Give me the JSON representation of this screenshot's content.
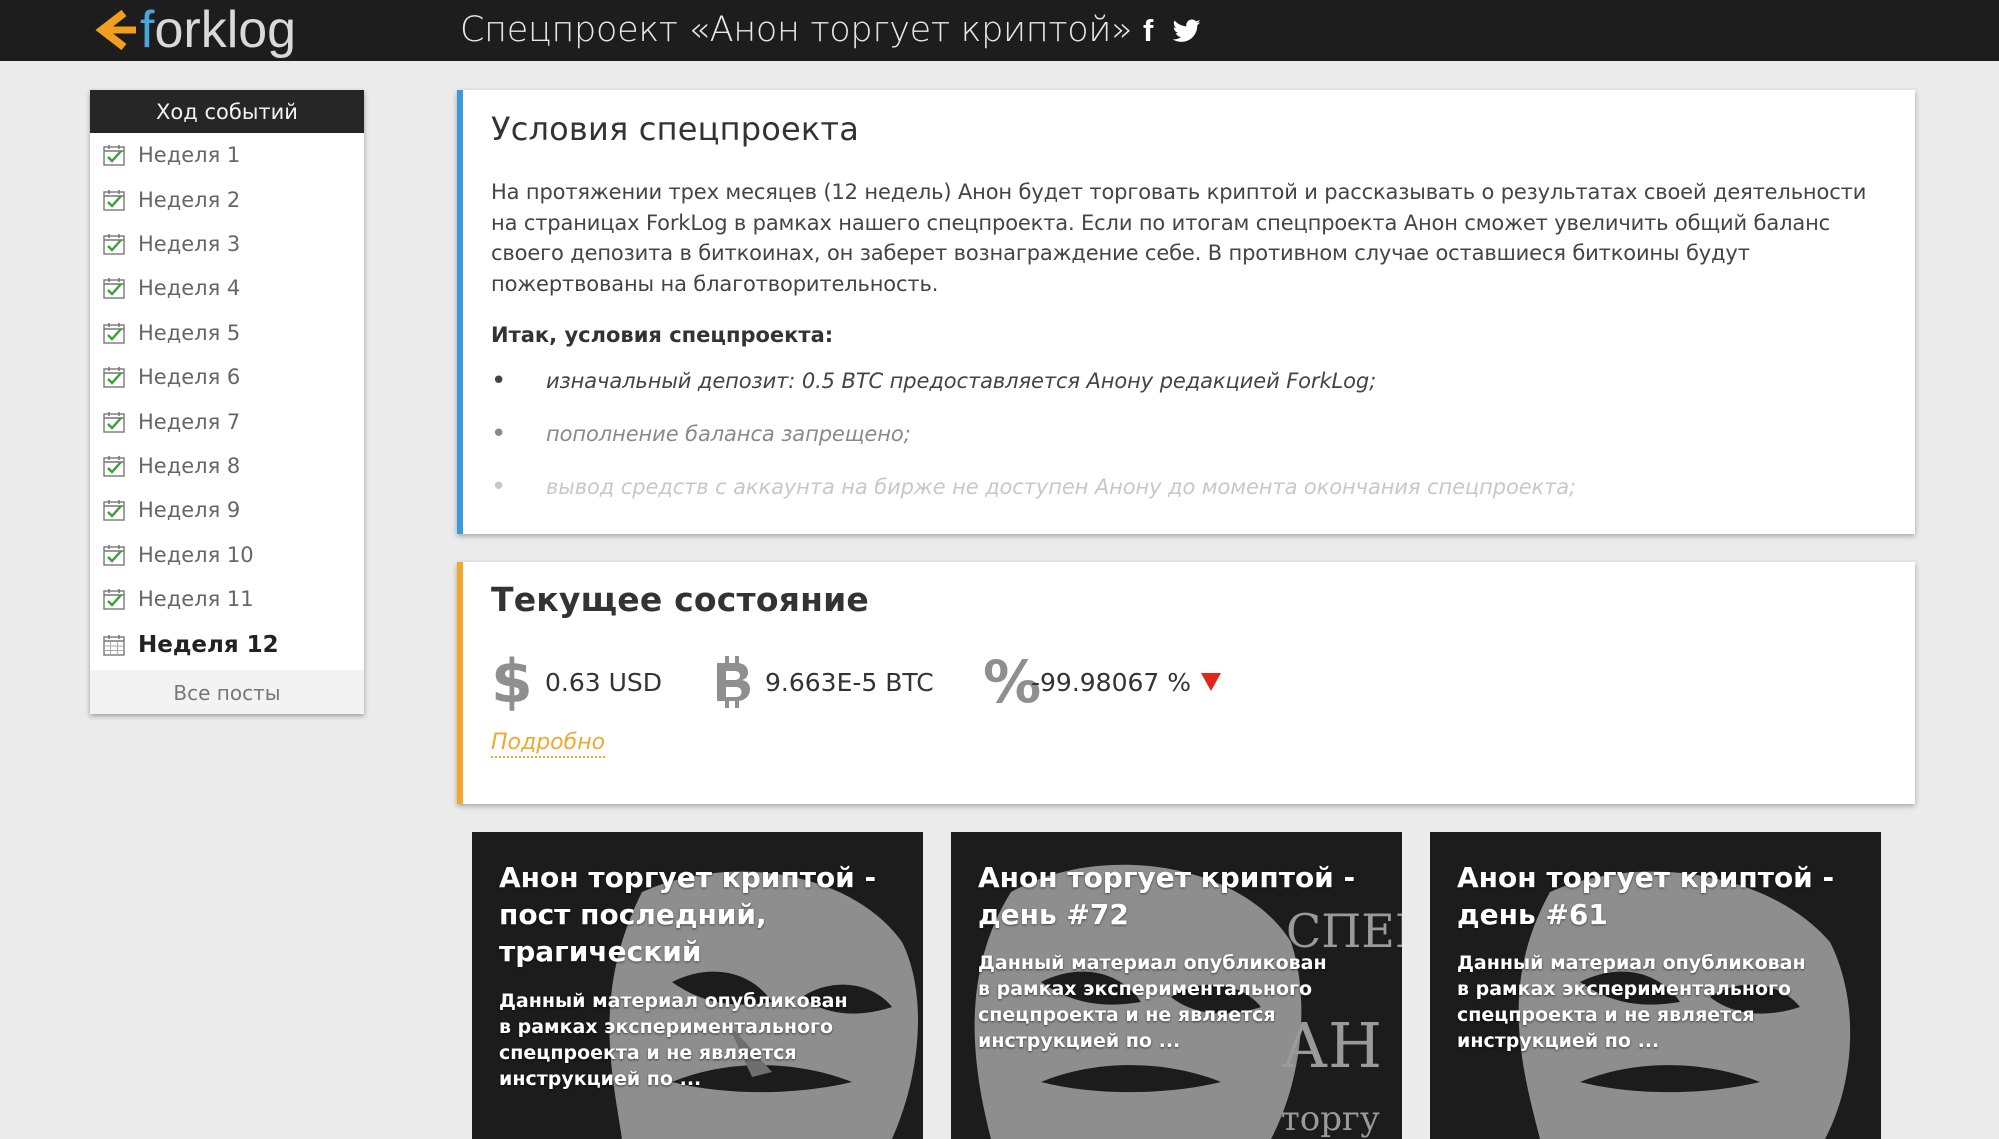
{
  "header": {
    "logo_parts": [
      "<",
      "f",
      "orklog"
    ],
    "project_title": "Спецпроект «Анон торгует криптой»",
    "facebook_label": "f"
  },
  "sidebar": {
    "heading": "Ход событий",
    "items": [
      {
        "label": "Неделя 1",
        "done": true
      },
      {
        "label": "Неделя 2",
        "done": true
      },
      {
        "label": "Неделя 3",
        "done": true
      },
      {
        "label": "Неделя 4",
        "done": true
      },
      {
        "label": "Неделя 5",
        "done": true
      },
      {
        "label": "Неделя 6",
        "done": true
      },
      {
        "label": "Неделя 7",
        "done": true
      },
      {
        "label": "Неделя 8",
        "done": true
      },
      {
        "label": "Неделя 9",
        "done": true
      },
      {
        "label": "Неделя 10",
        "done": true
      },
      {
        "label": "Неделя 11",
        "done": true
      },
      {
        "label": "Неделя 12",
        "done": false,
        "active": true
      }
    ],
    "all_posts": "Все посты"
  },
  "conditions": {
    "title": "Условия спецпроекта",
    "intro": "На протяжении трех месяцев (12 недель) Анон будет торговать криптой и рассказывать о результатах своей деятельности на страницах ForkLog в рамках нашего спецпроекта. Если по итогам спецпроекта Анон сможет увеличить общий баланс своего депозита в биткоинах, он заберет вознаграждение себе. В противном случае оставшиеся биткоины будут пожертвованы на благотворительность.",
    "list_heading": "Итак, условия спецпроекта:",
    "items": [
      "изначальный депозит: 0.5 BTC предоставляется Анону редакцией ForkLog;",
      "пополнение баланса запрещено;",
      "вывод средств с аккаунта на бирже не доступен Анону до момента окончания спецпроекта;"
    ]
  },
  "status": {
    "title": "Текущее состояние",
    "usd_symbol": "$",
    "usd_value": "0.63 USD",
    "btc_value": "9.663E-5 BTC",
    "pct_symbol": "%",
    "pct_value": "-99.98067 %",
    "trend": "down",
    "more_link": "Подробно"
  },
  "posts": [
    {
      "title": "Анон торгует криптой - пост последний, трагический",
      "excerpt": "Данный материал опубликован в рамках экспериментального спецпроекта и не является инструкцией по ..."
    },
    {
      "title": "Анон торгует криптой - день #72",
      "excerpt": "Данный материал опубликован в рамках экспериментального спецпроекта и не является инструкцией по ...",
      "art_text": [
        "СПЕЦ",
        "АН",
        "торгу"
      ]
    },
    {
      "title": "Анон торгует криптой - день #61",
      "excerpt": "Данный материал опубликован в рамках экспериментального спецпроекта и не является инструкцией по ..."
    }
  ],
  "colors": {
    "topbar": "#1d1d1d",
    "logo_orange": "#f29f1f",
    "logo_blue": "#45a8dc",
    "conditions_accent": "#3c9ad8",
    "status_accent": "#f0a830",
    "trend_down": "#e0251b"
  },
  "icons": {
    "logo": "forklog-chevron-icon",
    "facebook": "facebook-icon",
    "twitter": "twitter-icon",
    "week_done": "calendar-check-icon",
    "week_current": "calendar-icon",
    "usd": "dollar-icon",
    "btc": "bitcoin-icon",
    "percent": "percent-icon",
    "trend": "triangle-down-icon"
  }
}
